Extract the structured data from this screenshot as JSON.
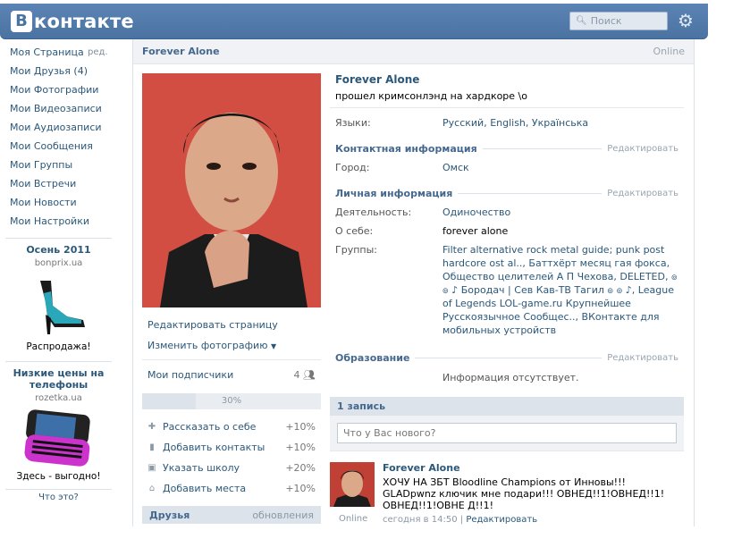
{
  "header": {
    "logo_letter": "В",
    "logo_text": "контакте",
    "search_placeholder": "Поиск"
  },
  "nav": {
    "items": [
      {
        "label": "Моя Страница",
        "extra": "ред."
      },
      {
        "label": "Мои Друзья (4)"
      },
      {
        "label": "Мои Фотографии"
      },
      {
        "label": "Мои Видеозаписи"
      },
      {
        "label": "Мои Аудиозаписи"
      },
      {
        "label": "Мои Сообщения"
      },
      {
        "label": "Мои Группы"
      },
      {
        "label": "Мои Встречи"
      },
      {
        "label": "Мои Новости"
      },
      {
        "label": "Мои Настройки"
      }
    ]
  },
  "ads": [
    {
      "title": "Осень 2011",
      "domain": "bonprix.ua",
      "caption": "Распродажа!"
    },
    {
      "title": "Низкие цены на телефоны",
      "domain": "rozetka.ua",
      "caption": "Здесь - выгодно!"
    }
  ],
  "ads_footer": "Что это?",
  "profile": {
    "header_name": "Forever Alone",
    "header_status": "Online",
    "name": "Forever Alone",
    "status": "прошел кримсонлэнд на хардкоре \\o",
    "edit_page": "Редактировать страницу",
    "change_photo": "Изменить фотографию",
    "subscribers_label": "Мои подписчики",
    "subscribers_count": "4",
    "progress_percent": 30,
    "progress_text": "30%",
    "tasks": [
      {
        "label": "Рассказать о себе",
        "pct": "+10%",
        "icon": "plus-icon"
      },
      {
        "label": "Добавить контакты",
        "pct": "+10%",
        "icon": "phone-icon"
      },
      {
        "label": "Указать школу",
        "pct": "+20%",
        "icon": "briefcase-icon"
      },
      {
        "label": "Добавить места",
        "pct": "+10%",
        "icon": "home-icon"
      }
    ],
    "friends_title": "Друзья",
    "friends_updates": "обновления"
  },
  "info": {
    "languages_label": "Языки:",
    "languages": [
      "Русский",
      "English",
      "Українська"
    ],
    "contacts_title": "Контактная информация",
    "edit_label": "Редактировать",
    "city_label": "Город:",
    "city": "Омск",
    "personal_title": "Личная информация",
    "activity_label": "Деятельность:",
    "activity": "Одиночество",
    "about_label": "О себе:",
    "about": "forever alone",
    "groups_label": "Группы:",
    "groups": "Filter alternative rock metal guide; punk post hardcore ost al.., Баттхёрт месяц гая фокса, Общество целителей А П Чехова, DELETED, ๏ ๏ ♪ Бородач | Сев Кав-ТВ Тагил ๏ ๏ ♪, League of Legends LOL-game.ru Крупнейшее Русскоязычное Сообщес.., ВКонтакте для мобильных устройств",
    "education_title": "Образование",
    "education_empty": "Информация отсутствует."
  },
  "wall": {
    "count_title": "1 запись",
    "input_placeholder": "Что у Вас нового?",
    "post": {
      "author": "Forever Alone",
      "online": "Online",
      "text": "ХОЧУ НА ЗБТ Bloodline Champions от Инновы!!! GLADpwnz ключик мне подари!!! ОВНЕД!!1!ОВНЕД!!1!ОВНЕД!!1!ОВНЕ Д!!1!",
      "time": "сегодня в 14:50",
      "edit": "Редактировать"
    }
  }
}
